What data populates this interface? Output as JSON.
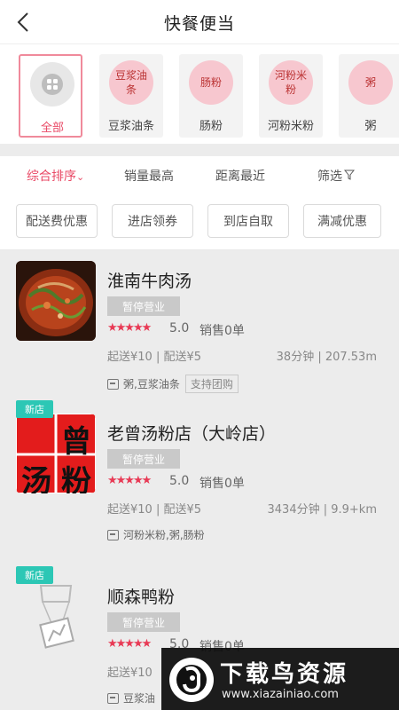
{
  "header": {
    "title": "快餐便当",
    "back_icon": "back-arrow-icon"
  },
  "categories": [
    {
      "circle": "",
      "label": "全部",
      "icon": "grid-icon",
      "active": true
    },
    {
      "circle": "豆浆油条",
      "label": "豆浆油条"
    },
    {
      "circle": "肠粉",
      "label": "肠粉"
    },
    {
      "circle": "河粉米粉",
      "label": "河粉米粉"
    },
    {
      "circle": "粥",
      "label": "粥"
    }
  ],
  "sort": {
    "comprehensive": "综合排序",
    "sales": "销量最高",
    "distance": "距离最近",
    "filter": "筛选"
  },
  "tags": [
    "配送费优惠",
    "进店领券",
    "到店自取",
    "满减优惠"
  ],
  "shops": [
    {
      "name": "淮南牛肉汤",
      "status": "暂停营业",
      "stars": "★★★★★",
      "rating": "5.0",
      "sales": "销售0单",
      "delivery": "起送¥10 | 配送¥5",
      "distance": "38分钟 | 207.53m",
      "categories": "粥,豆浆油条",
      "badge": "支持团购",
      "new_label": ""
    },
    {
      "name": "老曾汤粉店（大岭店）",
      "status": "暂停营业",
      "stars": "★★★★★",
      "rating": "5.0",
      "sales": "销售0单",
      "delivery": "起送¥10 | 配送¥5",
      "distance": "3434分钟 | 9.9+km",
      "categories": "河粉米粉,粥,肠粉",
      "new_label": "新店",
      "logo_text": [
        "曾",
        "汤",
        "粉"
      ]
    },
    {
      "name": "顺森鸭粉",
      "status": "暂停营业",
      "stars": "★★★★★",
      "rating": "5.0",
      "sales": "销售0单",
      "delivery": "起送¥10",
      "categories": "豆浆油",
      "new_label": "新店"
    }
  ],
  "watermark": {
    "title": "下载鸟资源",
    "url": "www.xiazainiao.com"
  },
  "colors": {
    "accent": "#e94a66",
    "new_tag": "#2cc7b5",
    "status": "#c9c9c9",
    "circle": "#f7c7cf"
  }
}
